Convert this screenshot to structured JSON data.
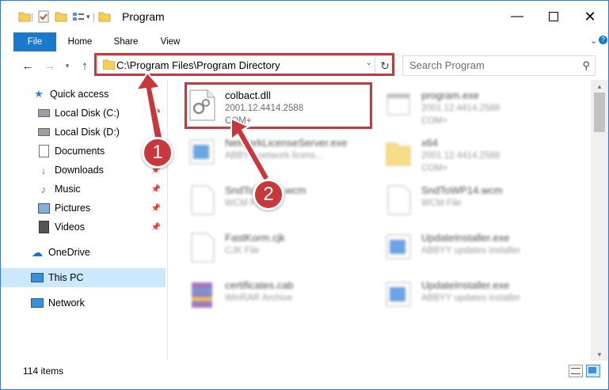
{
  "window": {
    "title": "Program"
  },
  "ribbon": {
    "tabs": [
      "File",
      "Home",
      "Share",
      "View"
    ]
  },
  "address": {
    "path": "C:\\Program Files\\Program Directory"
  },
  "search": {
    "placeholder": "Search Program"
  },
  "nav": {
    "items": [
      {
        "label": "Quick access",
        "icon": "star-icon"
      },
      {
        "label": "Local Disk (C:)",
        "icon": "drive-icon"
      },
      {
        "label": "Local Disk (D:)",
        "icon": "drive-icon"
      },
      {
        "label": "Documents",
        "icon": "documents-icon"
      },
      {
        "label": "Downloads",
        "icon": "download-icon"
      },
      {
        "label": "Music",
        "icon": "music-icon"
      },
      {
        "label": "Pictures",
        "icon": "pictures-icon"
      },
      {
        "label": "Videos",
        "icon": "videos-icon"
      },
      {
        "label": "OneDrive",
        "icon": "cloud-icon"
      },
      {
        "label": "This PC",
        "icon": "computer-icon"
      },
      {
        "label": "Network",
        "icon": "network-icon"
      }
    ]
  },
  "files": [
    {
      "name": "colbact.dll",
      "meta": "2001.12.4414.2588",
      "meta2": "COM+"
    },
    {
      "name": "program.exe",
      "meta": "2001.12.4414.2588",
      "meta2": "COM+"
    },
    {
      "name": "NetworkLicenseServer.exe",
      "meta": "ABBYY network licens...",
      "meta2": ""
    },
    {
      "name": "x64",
      "meta": "2001.12.4414.2588",
      "meta2": "COM+"
    },
    {
      "name": "SndToWP14.wcm",
      "meta": "WCM File",
      "meta2": ""
    },
    {
      "name": "SndToWP14.wcm",
      "meta": "WCM File",
      "meta2": ""
    },
    {
      "name": "FastKorm.cjk",
      "meta": "CJK File",
      "meta2": ""
    },
    {
      "name": "UpdateInstaller.exe",
      "meta": "ABBYY updates installer",
      "meta2": ""
    },
    {
      "name": "certificates.cab",
      "meta": "WinRAR Archive",
      "meta2": ""
    },
    {
      "name": "UpdateInstaller.exe",
      "meta": "ABBYY updates installer",
      "meta2": ""
    }
  ],
  "status": {
    "items_count": "114 items"
  },
  "steps": {
    "one": "1",
    "two": "2"
  },
  "colors": {
    "accent": "#1979ca",
    "highlight": "#c8373b",
    "selected": "#cce8ff"
  }
}
